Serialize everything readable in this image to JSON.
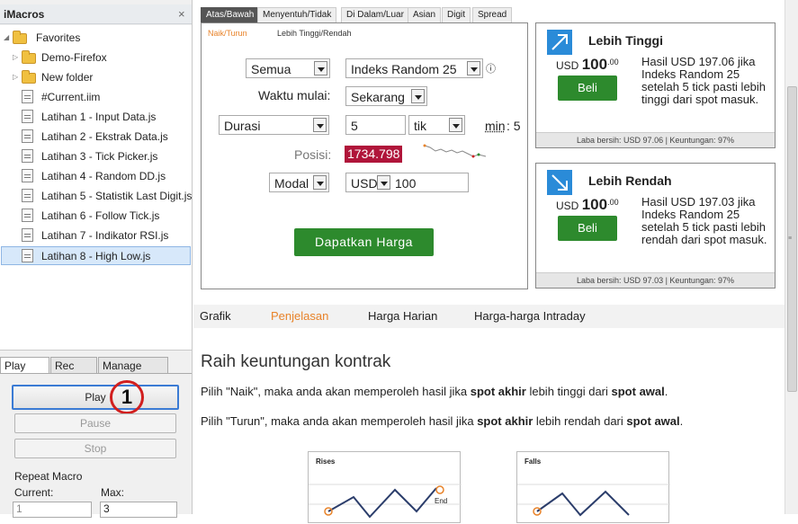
{
  "imacros": {
    "title": "iMacros",
    "close": "×",
    "tree": [
      {
        "label": "Favorites",
        "type": "folder"
      },
      {
        "label": "Demo-Firefox",
        "type": "folder"
      },
      {
        "label": "New folder",
        "type": "folder"
      },
      {
        "label": "#Current.iim",
        "type": "file"
      },
      {
        "label": "Latihan 1 - Input Data.js",
        "type": "file"
      },
      {
        "label": "Latihan 2 - Ekstrak Data.js",
        "type": "file"
      },
      {
        "label": "Latihan 3 - Tick Picker.js",
        "type": "file"
      },
      {
        "label": "Latihan 4 - Random DD.js",
        "type": "file"
      },
      {
        "label": "Latihan 5 - Statistik Last Digit.js",
        "type": "file"
      },
      {
        "label": "Latihan 6 - Follow Tick.js",
        "type": "file"
      },
      {
        "label": "Latihan 7 - Indikator RSI.js",
        "type": "file"
      },
      {
        "label": "Latihan 8 - High Low.js",
        "type": "file",
        "selected": true
      }
    ],
    "tabs": [
      "Play",
      "Rec",
      "Manage"
    ],
    "play_label": "Play",
    "pause_label": "Pause",
    "stop_label": "Stop",
    "badge": "1",
    "repeat_label": "Repeat Macro",
    "current_label": "Current:",
    "max_label": "Max:",
    "current_value": "1",
    "max_value": "3"
  },
  "trade": {
    "tabs": [
      "Atas/Bawah",
      "Menyentuh/Tidak",
      "Di Dalam/Luar",
      "Asian",
      "Digit",
      "Spread"
    ],
    "subtab_1": "Naik/Turun",
    "subtab_2": "Lebih Tinggi/Rendah",
    "market_type": "Semua",
    "market": "Indeks Random 25",
    "info_icon": "ⓘ",
    "start_label": "Waktu mulai:",
    "start_value": "Sekarang",
    "duration_type": "Durasi",
    "duration_value": "5",
    "duration_unit": "tik",
    "min_label": "min",
    "min_value": ": 5",
    "spot_label": "Posisi:",
    "spot_value": "1734.798",
    "amount_type": "Modal",
    "currency": "USD",
    "amount": "100",
    "button": "Dapatkan Harga"
  },
  "cards": [
    {
      "title": "Lebih Tinggi",
      "currency": "USD",
      "price": "100",
      "cents": ".00",
      "buy": "Beli",
      "desc": "Hasil USD 197.06 jika Indeks Random 25 setelah 5 tick pasti lebih tinggi dari spot masuk.",
      "footer": "Laba bersih: USD 97.06 | Keuntungan: 97%"
    },
    {
      "title": "Lebih Rendah",
      "currency": "USD",
      "price": "100",
      "cents": ".00",
      "buy": "Beli",
      "desc": "Hasil USD 197.03 jika Indeks Random 25 setelah 5 tick pasti lebih rendah dari spot masuk.",
      "footer": "Laba bersih: USD 97.03 | Keuntungan: 97%"
    }
  ],
  "info_tabs": [
    "Grafik",
    "Penjelasan",
    "Harga Harian",
    "Harga-harga Intraday"
  ],
  "accent_color": "#e8832a",
  "content": {
    "heading": "Raih keuntungan kontrak",
    "p1_a": "Pilih \"Naik\", maka anda akan memperoleh hasil jika ",
    "p1_b": "spot akhir",
    "p1_c": " lebih tinggi dari ",
    "p1_d": "spot awal",
    "p1_e": ".",
    "p2_a": "Pilih \"Turun\", maka anda akan memperoleh hasil jika ",
    "p2_b": "spot akhir",
    "p2_c": " lebih rendah dari ",
    "p2_d": "spot awal",
    "p2_e": ".",
    "chart1_title": "Rises",
    "chart1_end": "End",
    "chart2_title": "Falls"
  }
}
